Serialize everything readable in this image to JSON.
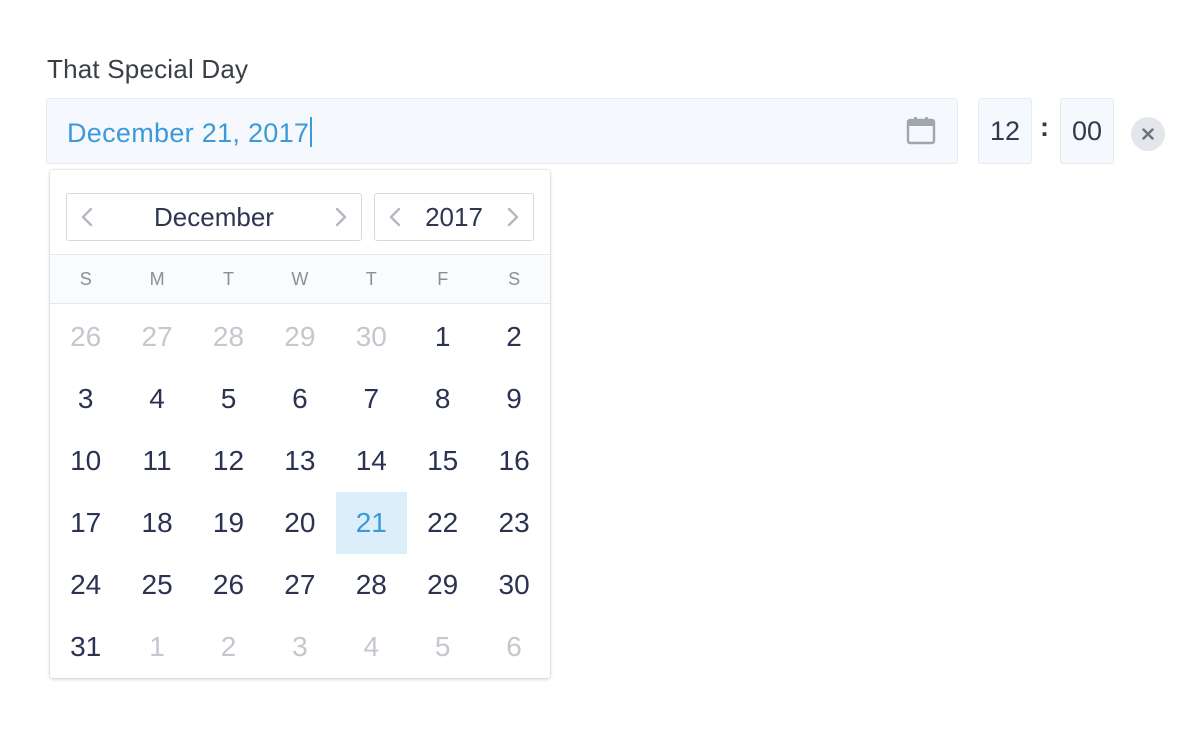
{
  "form": {
    "label": "That Special Day",
    "date_value": "December 21, 2017",
    "time": {
      "hour": "12",
      "separator": ":",
      "minute": "00"
    }
  },
  "calendar": {
    "month": "December",
    "year": "2017",
    "weekdays": [
      "S",
      "M",
      "T",
      "W",
      "T",
      "F",
      "S"
    ],
    "weeks": [
      [
        [
          "26",
          "muted"
        ],
        [
          "27",
          "muted"
        ],
        [
          "28",
          "muted"
        ],
        [
          "29",
          "muted"
        ],
        [
          "30",
          "muted"
        ],
        [
          "1",
          ""
        ],
        [
          "2",
          ""
        ]
      ],
      [
        [
          "3",
          ""
        ],
        [
          "4",
          ""
        ],
        [
          "5",
          ""
        ],
        [
          "6",
          ""
        ],
        [
          "7",
          ""
        ],
        [
          "8",
          ""
        ],
        [
          "9",
          ""
        ]
      ],
      [
        [
          "10",
          ""
        ],
        [
          "11",
          ""
        ],
        [
          "12",
          ""
        ],
        [
          "13",
          ""
        ],
        [
          "14",
          ""
        ],
        [
          "15",
          ""
        ],
        [
          "16",
          ""
        ]
      ],
      [
        [
          "17",
          ""
        ],
        [
          "18",
          ""
        ],
        [
          "19",
          ""
        ],
        [
          "20",
          ""
        ],
        [
          "21",
          "selected"
        ],
        [
          "22",
          ""
        ],
        [
          "23",
          ""
        ]
      ],
      [
        [
          "24",
          ""
        ],
        [
          "25",
          ""
        ],
        [
          "26",
          ""
        ],
        [
          "27",
          ""
        ],
        [
          "28",
          ""
        ],
        [
          "29",
          ""
        ],
        [
          "30",
          ""
        ]
      ],
      [
        [
          "31",
          ""
        ],
        [
          "1",
          "muted"
        ],
        [
          "2",
          "muted"
        ],
        [
          "3",
          "muted"
        ],
        [
          "4",
          "muted"
        ],
        [
          "5",
          "muted"
        ],
        [
          "6",
          "muted"
        ]
      ]
    ]
  },
  "icons": {
    "calendar": "calendar-icon",
    "clear": "close-icon",
    "prev": "chevron-left-icon",
    "next": "chevron-right-icon"
  },
  "colors": {
    "accent": "#3d9ad9",
    "selected_bg": "#dbeefa",
    "muted": "#c3c8ce",
    "text": "#2b3252"
  }
}
